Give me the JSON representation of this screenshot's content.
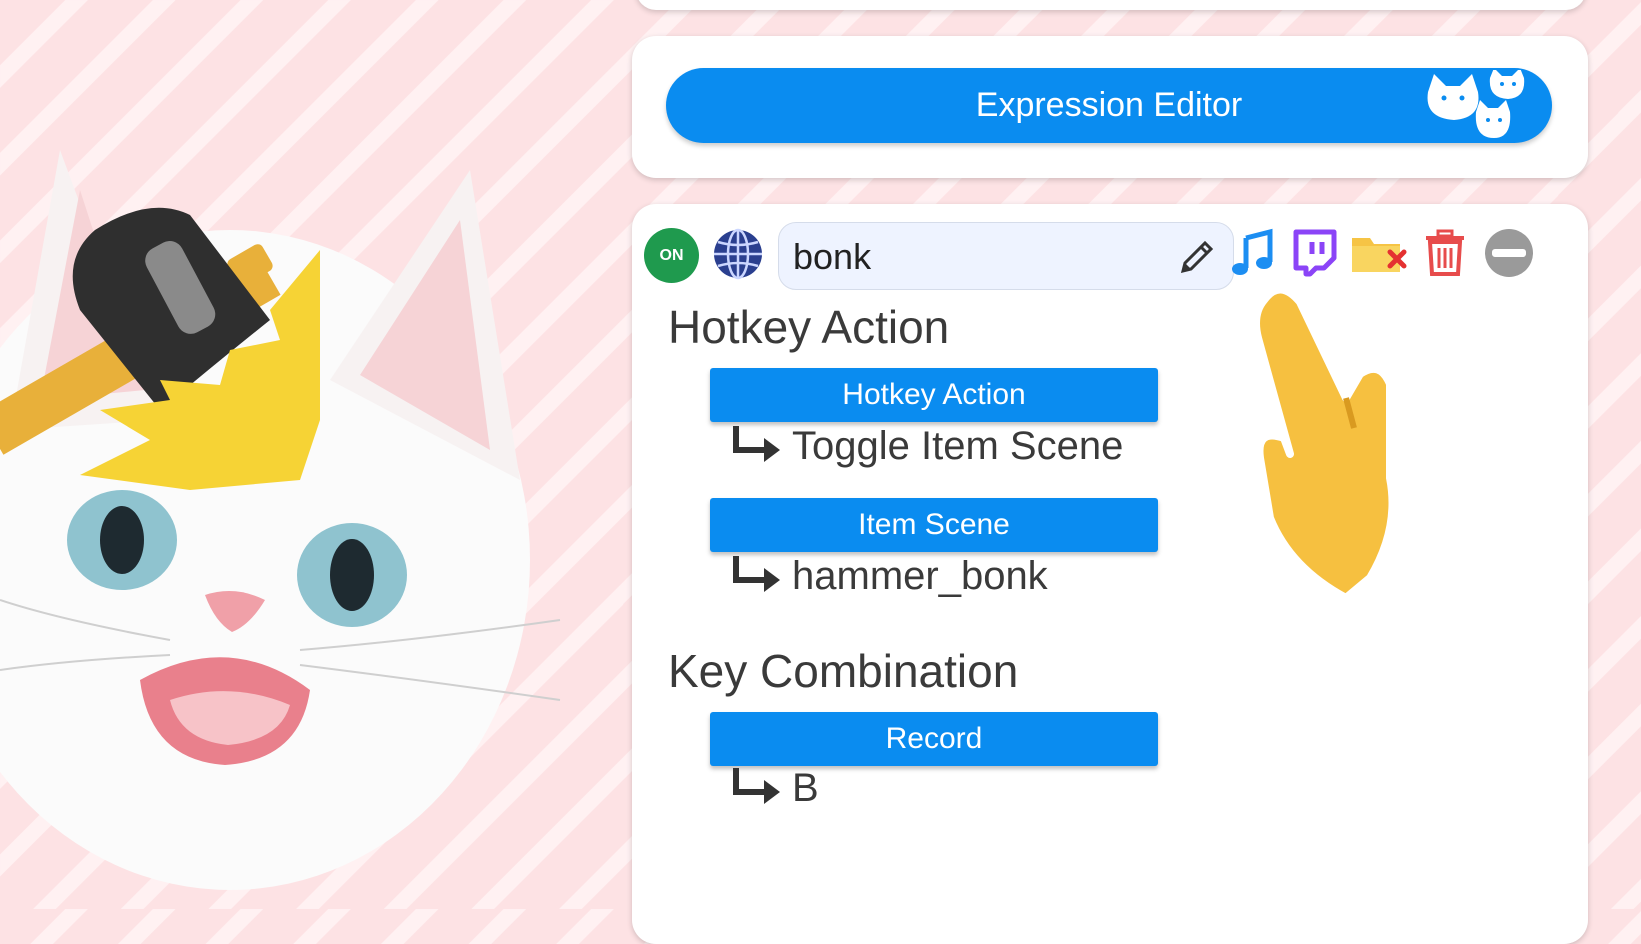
{
  "expression_editor": {
    "label": "Expression Editor",
    "icon": "cat-faces-icon"
  },
  "hotkey_item": {
    "status": "ON",
    "name_value": "bonk",
    "toolbar_icons": [
      "music-note-icon",
      "twitch-icon",
      "folder-remove-icon",
      "trash-icon",
      "minus-circle-icon"
    ]
  },
  "hotkey_action": {
    "title": "Hotkey Action",
    "button_label": "Hotkey Action",
    "value": "Toggle Item Scene"
  },
  "item_scene": {
    "button_label": "Item Scene",
    "value": "hammer_bonk"
  },
  "key_combination": {
    "title": "Key Combination",
    "button_label": "Record",
    "value": "B"
  },
  "colors": {
    "accent": "#0a8cf0",
    "on_green": "#1f9a4e",
    "background_pink": "#fde2e4"
  }
}
